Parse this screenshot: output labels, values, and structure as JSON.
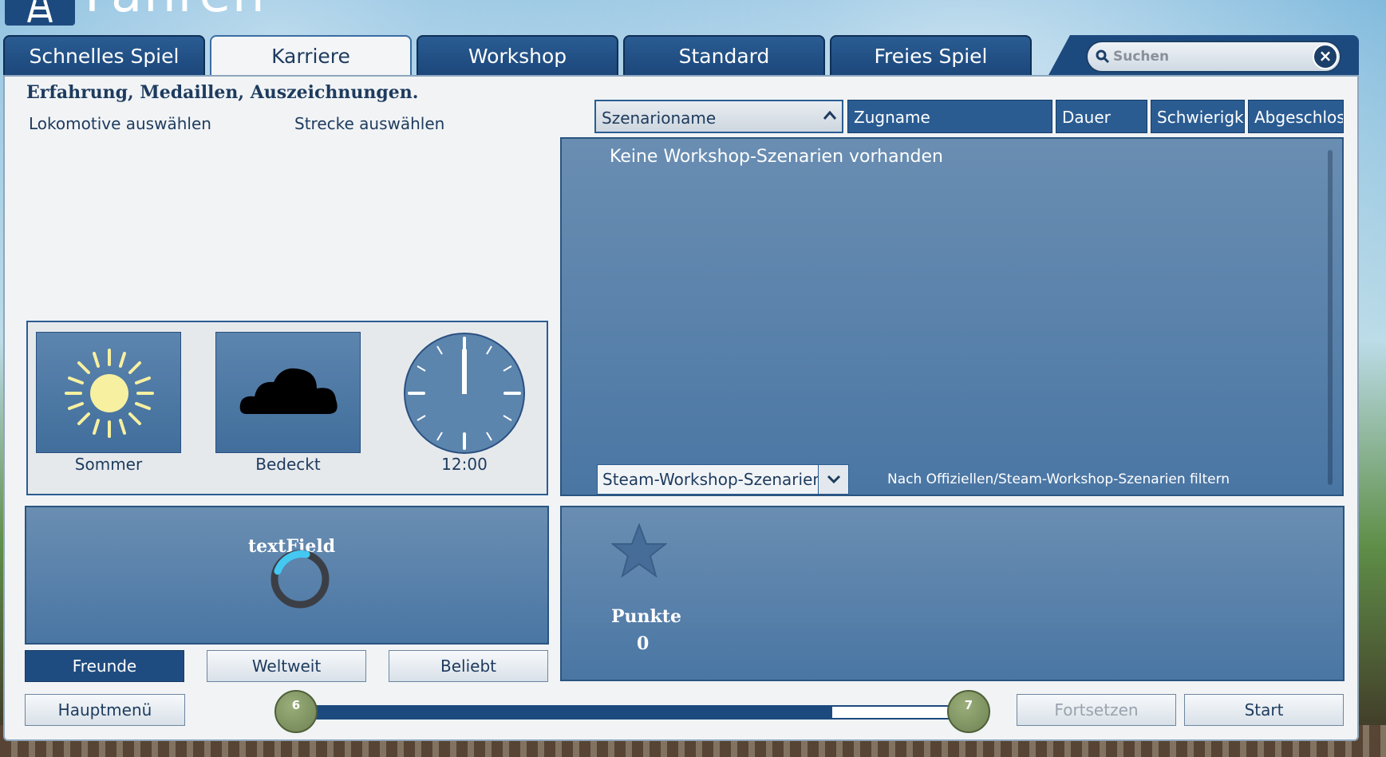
{
  "header": {
    "title": "Fahren"
  },
  "tabs": [
    {
      "label": "Schnelles Spiel",
      "active": false
    },
    {
      "label": "Karriere",
      "active": true
    },
    {
      "label": "Workshop",
      "active": false
    },
    {
      "label": "Standard",
      "active": false
    },
    {
      "label": "Freies Spiel",
      "active": false
    }
  ],
  "search": {
    "placeholder": "Suchen",
    "value": ""
  },
  "left": {
    "subtitle": "Erfahrung, Medaillen, Auszeichnungen.",
    "select_loco": "Lokomotive auswählen",
    "select_route": "Strecke auswählen"
  },
  "conditions": {
    "season": "Sommer",
    "weather": "Bedeckt",
    "time": "12:00"
  },
  "columns": [
    "Szenarioname",
    "Zugname",
    "Dauer",
    "Schwierigke",
    "Abgeschlos"
  ],
  "list": {
    "empty_text": "Keine Workshop-Szenarien vorhanden",
    "filter_value": "Steam-Workshop-Szenarien anzei",
    "filter_label": "Nach Offiziellen/Steam-Workshop-Szenarien filtern"
  },
  "leaderboard": {
    "placeholder_text": "textField",
    "buttons": [
      "Freunde",
      "Weltweit",
      "Beliebt"
    ]
  },
  "score": {
    "label": "Punkte",
    "value": "0"
  },
  "bottom": {
    "main_menu": "Hauptmenü",
    "continue": "Fortsetzen",
    "start": "Start",
    "level_current": "6",
    "level_next": "7",
    "progress": 0.82
  },
  "colors": {
    "primary": "#1d4a7e",
    "panel": "#f1f3f5",
    "accent_sun": "#f7f0a0"
  }
}
